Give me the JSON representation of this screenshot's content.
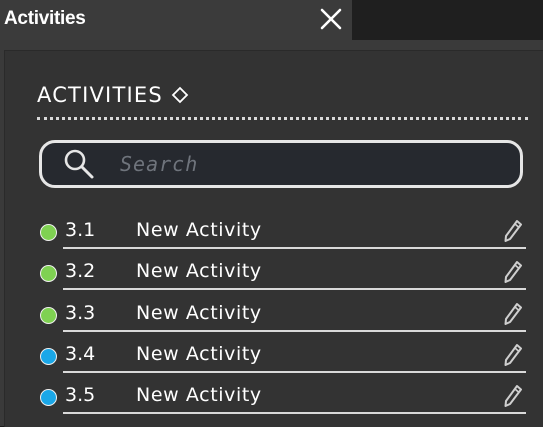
{
  "tab": {
    "title": "Activities",
    "close_icon": "close-icon"
  },
  "panel": {
    "heading": "ACTIVITIES",
    "heading_icon": "diamond-icon"
  },
  "search": {
    "placeholder": "Search",
    "value": "",
    "icon": "search-icon"
  },
  "colors": {
    "green": "#7fd152",
    "blue": "#1aa7e8"
  },
  "activities": [
    {
      "number": "3.1",
      "name": "New Activity",
      "status_color": "#7fd152"
    },
    {
      "number": "3.2",
      "name": "New Activity",
      "status_color": "#7fd152"
    },
    {
      "number": "3.3",
      "name": "New Activity",
      "status_color": "#7fd152"
    },
    {
      "number": "3.4",
      "name": "New Activity",
      "status_color": "#1aa7e8"
    },
    {
      "number": "3.5",
      "name": "New Activity",
      "status_color": "#1aa7e8"
    }
  ]
}
